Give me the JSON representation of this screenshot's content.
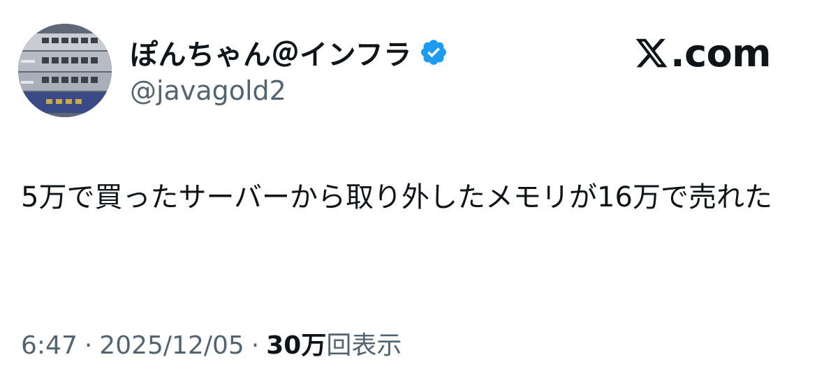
{
  "author": {
    "display_name": "ぽんちゃん＠インフラ",
    "handle": "@javagold2",
    "verified": true,
    "avatar_icon": "network-switch-photo-avatar"
  },
  "brand": {
    "logo_icon": "x-logo-icon",
    "text": ".com"
  },
  "tweet": {
    "text": "5万で買ったサーバーから取り外したメモリが16万で売れた"
  },
  "meta": {
    "time": "6:47",
    "separator": "·",
    "date": "2025/12/05",
    "views_count": "30万",
    "views_label": "回表示"
  },
  "colors": {
    "verified_blue": "#1d9bf0",
    "secondary_text": "#536471",
    "primary_text": "#0f1419"
  }
}
